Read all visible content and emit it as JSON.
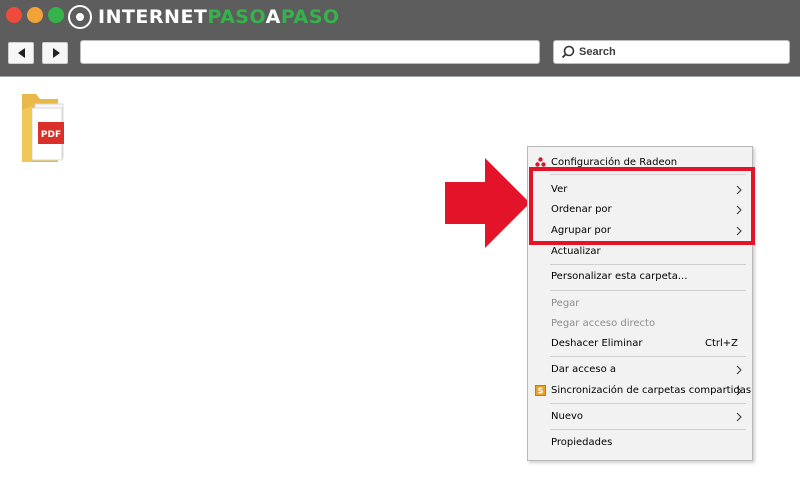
{
  "brand": {
    "part1": "INTERNET",
    "part2": "PASO",
    "part3": "A",
    "part4": "PASO"
  },
  "toolbar": {
    "search_placeholder": "Search"
  },
  "folder": {
    "badge": "PDF"
  },
  "colors": {
    "chrome": "#5d5d5d",
    "brand_green": "#35b34a",
    "highlight_red": "#e3132a",
    "menu_bg": "#f2f2f2"
  },
  "context_menu": {
    "items": {
      "radeon": "Configuración de Radeon",
      "ver": "Ver",
      "ordenar": "Ordenar por",
      "agrupar": "Agrupar por",
      "actualizar": "Actualizar",
      "personalizar": "Personalizar esta carpeta...",
      "pegar": "Pegar",
      "pegar_acceso": "Pegar acceso directo",
      "deshacer": "Deshacer Eliminar",
      "deshacer_shortcut": "Ctrl+Z",
      "dar_acceso": "Dar acceso a",
      "sincronizacion": "Sincronización de carpetas compartidas",
      "nuevo": "Nuevo",
      "propiedades": "Propiedades"
    }
  }
}
